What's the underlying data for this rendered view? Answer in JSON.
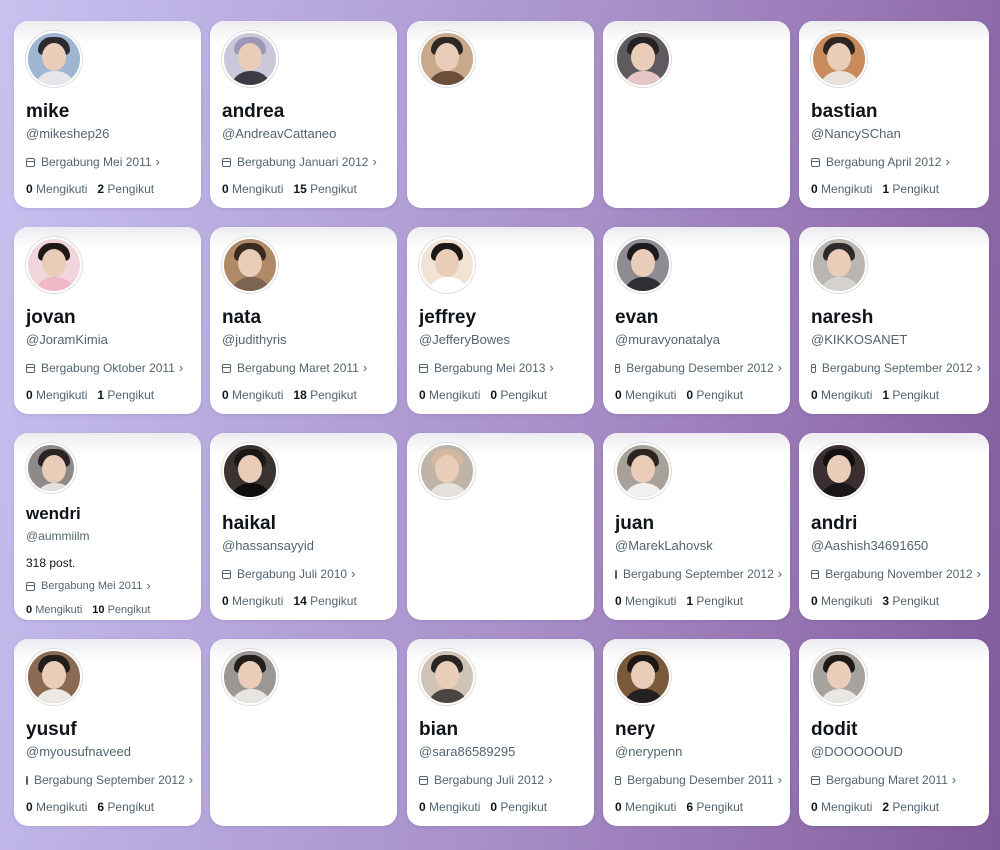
{
  "profiles": [
    {
      "name": "mike",
      "handle": "@mikeshep26",
      "joined": "Bergabung Mei 2011",
      "following": "0",
      "following_label": "Mengikuti",
      "followers": "2",
      "followers_label": "Pengikut",
      "colors": {
        "hair": "#2b2a2e",
        "body": "#e6e6ea",
        "bg": "#9fb5d1"
      }
    },
    {
      "name": "andrea",
      "handle": "@AndreavCattaneo",
      "joined": "Bergabung Januari 2012",
      "following": "0",
      "following_label": "Mengikuti",
      "followers": "15",
      "followers_label": "Pengikut",
      "colors": {
        "hair": "#9c97b4",
        "body": "#3b3b44",
        "bg": "#c9c7d8"
      }
    },
    {
      "name": "",
      "handle": "",
      "joined": "",
      "following": "",
      "following_label": "",
      "followers": "",
      "followers_label": "",
      "colors": {
        "hair": "#2f2723",
        "body": "#6b4d3a",
        "bg": "#c9a98b"
      }
    },
    {
      "name": "",
      "handle": "",
      "joined": "",
      "following": "",
      "following_label": "",
      "followers": "",
      "followers_label": "",
      "colors": {
        "hair": "#262223",
        "body": "#e6c7c7",
        "bg": "#5e5a60"
      }
    },
    {
      "name": "bastian",
      "handle": "@NancySChan",
      "joined": "Bergabung April 2012",
      "following": "0",
      "following_label": "Mengikuti",
      "followers": "1",
      "followers_label": "Pengikut",
      "colors": {
        "hair": "#2f2520",
        "body": "#e8e2d8",
        "bg": "#c98a5c"
      }
    },
    {
      "name": "jovan",
      "handle": "@JoramKimia",
      "joined": "Bergabung Oktober 2011",
      "following": "0",
      "following_label": "Mengikuti",
      "followers": "1",
      "followers_label": "Pengikut",
      "colors": {
        "hair": "#1f1a18",
        "body": "#f0b8c4",
        "bg": "#f1d4dc"
      }
    },
    {
      "name": "nata",
      "handle": "@judithyris",
      "joined": "Bergabung Maret 2011",
      "following": "0",
      "following_label": "Mengikuti",
      "followers": "18",
      "followers_label": "Pengikut",
      "colors": {
        "hair": "#3a2b22",
        "body": "#7d6352",
        "bg": "#b08a66"
      }
    },
    {
      "name": "jeffrey",
      "handle": "@JefferyBowes",
      "joined": "Bergabung Mei 2013",
      "following": "0",
      "following_label": "Mengikuti",
      "followers": "0",
      "followers_label": "Pengikut",
      "colors": {
        "hair": "#1b1816",
        "body": "#ffffff",
        "bg": "#f2e3d4"
      }
    },
    {
      "name": "evan",
      "handle": "@muravyonatalya",
      "joined": "Bergabung Desember 2012",
      "following": "0",
      "following_label": "Mengikuti",
      "followers": "0",
      "followers_label": "Pengikut",
      "colors": {
        "hair": "#1c1a1c",
        "body": "#2e2e34",
        "bg": "#8e8c92"
      }
    },
    {
      "name": "naresh",
      "handle": "@KIKKOSANET",
      "joined": "Bergabung September 2012",
      "following": "0",
      "following_label": "Mengikuti",
      "followers": "1",
      "followers_label": "Pengikut",
      "colors": {
        "hair": "#2c2a2a",
        "body": "#d6d2cd",
        "bg": "#b9b5b1"
      }
    },
    {
      "name": "wendri",
      "handle": "@aummiilm",
      "posts": "318 post.",
      "joined": "Bergabung Mei 2011",
      "following": "0",
      "following_label": "Mengikuti",
      "followers": "10",
      "followers_label": "Pengikut",
      "colors": {
        "hair": "#2a2524",
        "body": "#e3e1df",
        "bg": "#8d8a89"
      }
    },
    {
      "name": "haikal",
      "handle": "@hassansayyid",
      "joined": "Bergabung Juli 2010",
      "following": "0",
      "following_label": "Mengikuti",
      "followers": "14",
      "followers_label": "Pengikut",
      "colors": {
        "hair": "#1a1716",
        "body": "#0e0c0c",
        "bg": "#3a3330"
      }
    },
    {
      "name": "",
      "handle": "",
      "joined": "",
      "following": "",
      "following_label": "",
      "followers": "",
      "followers_label": "",
      "colors": {
        "hair": "#d2b89e",
        "body": "#e4e0da",
        "bg": "#bfb3a8"
      }
    },
    {
      "name": "juan",
      "handle": "@MarekLahovsk",
      "joined": "Bergabung September 2012",
      "following": "0",
      "following_label": "Mengikuti",
      "followers": "1",
      "followers_label": "Pengikut",
      "colors": {
        "hair": "#2c2420",
        "body": "#f0f0f0",
        "bg": "#a8a19a"
      }
    },
    {
      "name": "andri",
      "handle": "@Aashish34691650",
      "joined": "Bergabung November 2012",
      "following": "0",
      "following_label": "Mengikuti",
      "followers": "3",
      "followers_label": "Pengikut",
      "colors": {
        "hair": "#141112",
        "body": "#1a1617",
        "bg": "#3a2e30"
      }
    },
    {
      "name": "yusuf",
      "handle": "@myousufnaveed",
      "joined": "Bergabung September 2012",
      "following": "0",
      "following_label": "Mengikuti",
      "followers": "6",
      "followers_label": "Pengikut",
      "colors": {
        "hair": "#231d1b",
        "body": "#ece8e3",
        "bg": "#8a6a52"
      }
    },
    {
      "name": "",
      "handle": "",
      "joined": "",
      "following": "",
      "following_label": "",
      "followers": "",
      "followers_label": "",
      "colors": {
        "hair": "#231e1c",
        "body": "#e7e5e2",
        "bg": "#9b9794"
      }
    },
    {
      "name": "bian",
      "handle": "@sara86589295",
      "joined": "Bergabung Juli 2012",
      "following": "0",
      "following_label": "Mengikuti",
      "followers": "0",
      "followers_label": "Pengikut",
      "colors": {
        "hair": "#2b2422",
        "body": "#4a4540",
        "bg": "#cfc3b6"
      }
    },
    {
      "name": "nery",
      "handle": "@nerypenn",
      "joined": "Bergabung Desember 2011",
      "following": "0",
      "following_label": "Mengikuti",
      "followers": "6",
      "followers_label": "Pengikut",
      "colors": {
        "hair": "#1d1715",
        "body": "#252020",
        "bg": "#7a5a3a"
      }
    },
    {
      "name": "dodit",
      "handle": "@DOOOOOUD",
      "joined": "Bergabung Maret 2011",
      "following": "0",
      "following_label": "Mengikuti",
      "followers": "2",
      "followers_label": "Pengikut",
      "colors": {
        "hair": "#1e1a19",
        "body": "#e9e7e4",
        "bg": "#a6a29e"
      }
    }
  ]
}
